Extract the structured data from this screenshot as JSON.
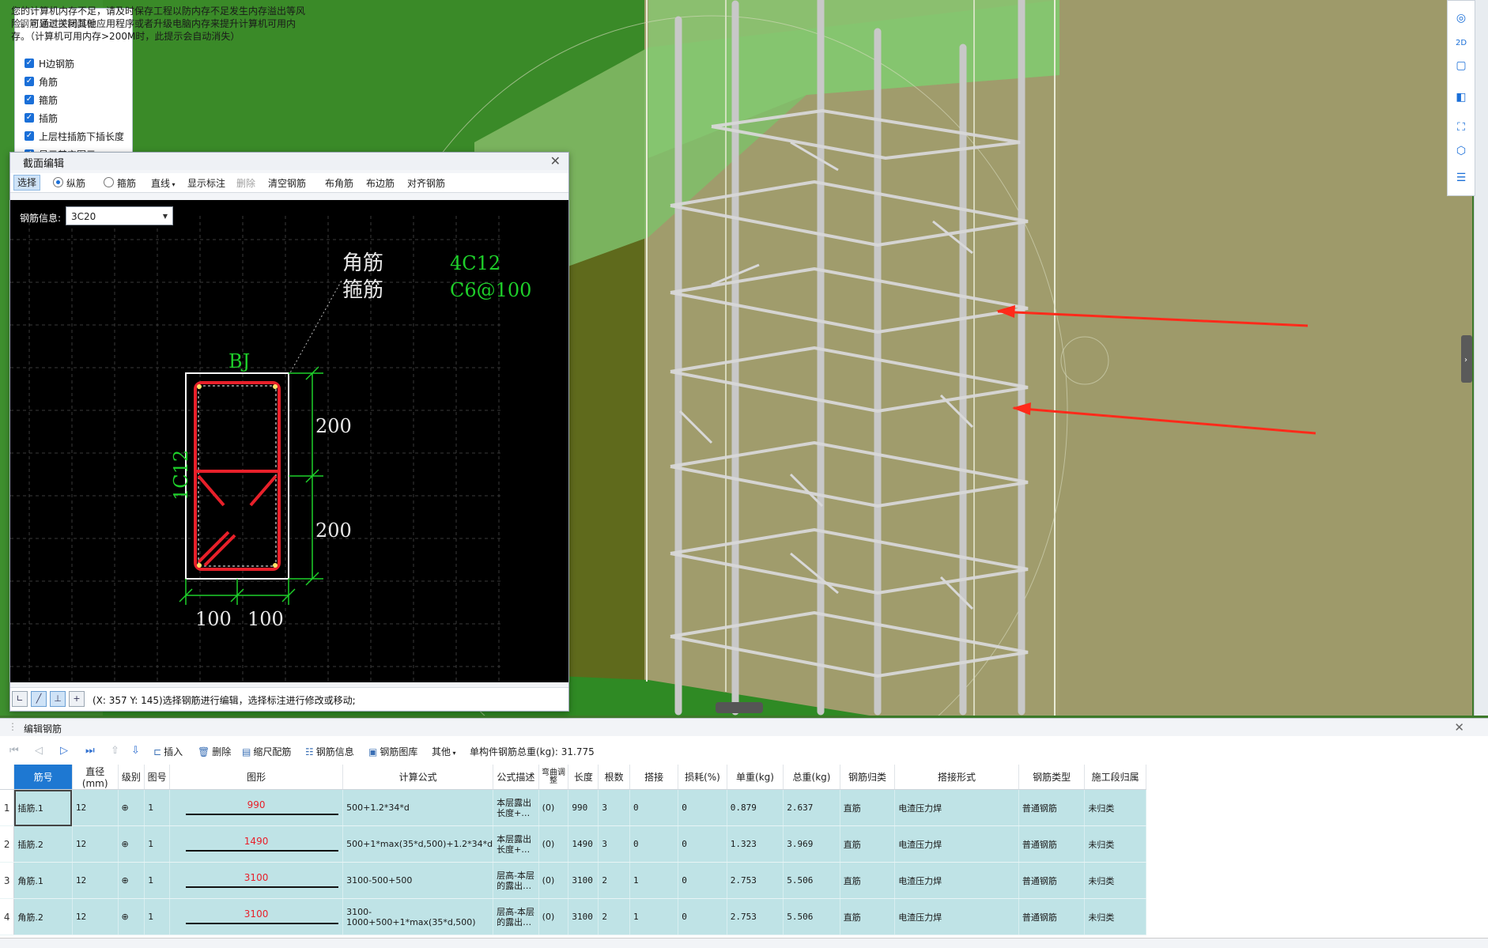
{
  "warning": {
    "line1": "您的计算机内存不足，请及时保存工程以防内存不足发生内存溢出等风",
    "line2": "险。可通过关闭其他应用程序或者升级电脑内存来提升计算机可用内",
    "line3": "存。（计算机可用内存>200M时，此提示会自动消失）"
  },
  "display_panel": {
    "title": "钢筋显示控制面板",
    "items": [
      "H边钢筋",
      "角筋",
      "箍筋",
      "插筋",
      "上层柱插筋下插长度",
      "显示其它图元"
    ]
  },
  "section_dialog": {
    "title": "截面编辑",
    "toolbar": {
      "select": "选择",
      "radio_longitudinal": "纵筋",
      "radio_stirrup": "箍筋",
      "line": "直线",
      "show_annotation": "显示标注",
      "delete": "删除",
      "clear": "清空钢筋",
      "corner": "布角筋",
      "edge": "布边筋",
      "align": "对齐钢筋"
    },
    "rebar_info_label": "钢筋信息:",
    "rebar_info_value": "3C20",
    "drawing": {
      "label_corner": "角筋",
      "label_stirrup": "箍筋",
      "spec_corner": "4C12",
      "spec_stirrup": "C6@100",
      "bj": "BJ",
      "side": "1C12",
      "dim_v1": "200",
      "dim_v2": "200",
      "dim_h1": "100",
      "dim_h2": "100"
    },
    "status": "(X: 357 Y: 145)选择钢筋进行编辑，选择标注进行修改或移动;"
  },
  "bottom_panel": {
    "title": "编辑钢筋",
    "toolbar": {
      "insert": "插入",
      "delete": "删除",
      "scale": "缩尺配筋",
      "info": "钢筋信息",
      "library": "钢筋图库",
      "other": "其他",
      "total_label": "单构件钢筋总重(kg): 31.775"
    },
    "columns": [
      "筋号",
      "直径(mm)",
      "级别",
      "图号",
      "图形",
      "计算公式",
      "公式描述",
      "弯曲调整",
      "长度",
      "根数",
      "搭接",
      "损耗(%)",
      "单重(kg)",
      "总重(kg)",
      "钢筋归类",
      "搭接形式",
      "钢筋类型",
      "施工段归属"
    ],
    "rows": [
      {
        "rn": "1",
        "name": "插筋.1",
        "dia": "12",
        "grade": "⊕",
        "fig": "1",
        "shape": "990",
        "formula": "500+1.2*34*d",
        "desc": "本层露出长度+…",
        "bend": "(0)",
        "len": "990",
        "count": "3",
        "lap": "0",
        "loss": "0",
        "unit": "0.879",
        "total": "2.637",
        "cls": "直筋",
        "laptype": "电渣压力焊",
        "type": "普通钢筋",
        "stage": "未归类"
      },
      {
        "rn": "2",
        "name": "插筋.2",
        "dia": "12",
        "grade": "⊕",
        "fig": "1",
        "shape": "1490",
        "formula": "500+1*max(35*d,500)+1.2*34*d",
        "desc": "本层露出长度+…",
        "bend": "(0)",
        "len": "1490",
        "count": "3",
        "lap": "0",
        "loss": "0",
        "unit": "1.323",
        "total": "3.969",
        "cls": "直筋",
        "laptype": "电渣压力焊",
        "type": "普通钢筋",
        "stage": "未归类"
      },
      {
        "rn": "3",
        "name": "角筋.1",
        "dia": "12",
        "grade": "⊕",
        "fig": "1",
        "shape": "3100",
        "formula": "3100-500+500",
        "desc": "层高-本层的露出…",
        "bend": "(0)",
        "len": "3100",
        "count": "2",
        "lap": "1",
        "loss": "0",
        "unit": "2.753",
        "total": "5.506",
        "cls": "直筋",
        "laptype": "电渣压力焊",
        "type": "普通钢筋",
        "stage": "未归类"
      },
      {
        "rn": "4",
        "name": "角筋.2",
        "dia": "12",
        "grade": "⊕",
        "fig": "1",
        "shape": "3100",
        "formula": "3100-1000+500+1*max(35*d,500)",
        "desc": "层高-本层的露出…",
        "bend": "(0)",
        "len": "3100",
        "count": "2",
        "lap": "1",
        "loss": "0",
        "unit": "2.753",
        "total": "5.506",
        "cls": "直筋",
        "laptype": "电渣压力焊",
        "type": "普通钢筋",
        "stage": "未归类"
      }
    ]
  },
  "colors": {
    "accent": "#1e78d2",
    "rebar": "#e8202a",
    "annotation": "#1ecf2a",
    "row_bg": "#bfe3e6"
  }
}
